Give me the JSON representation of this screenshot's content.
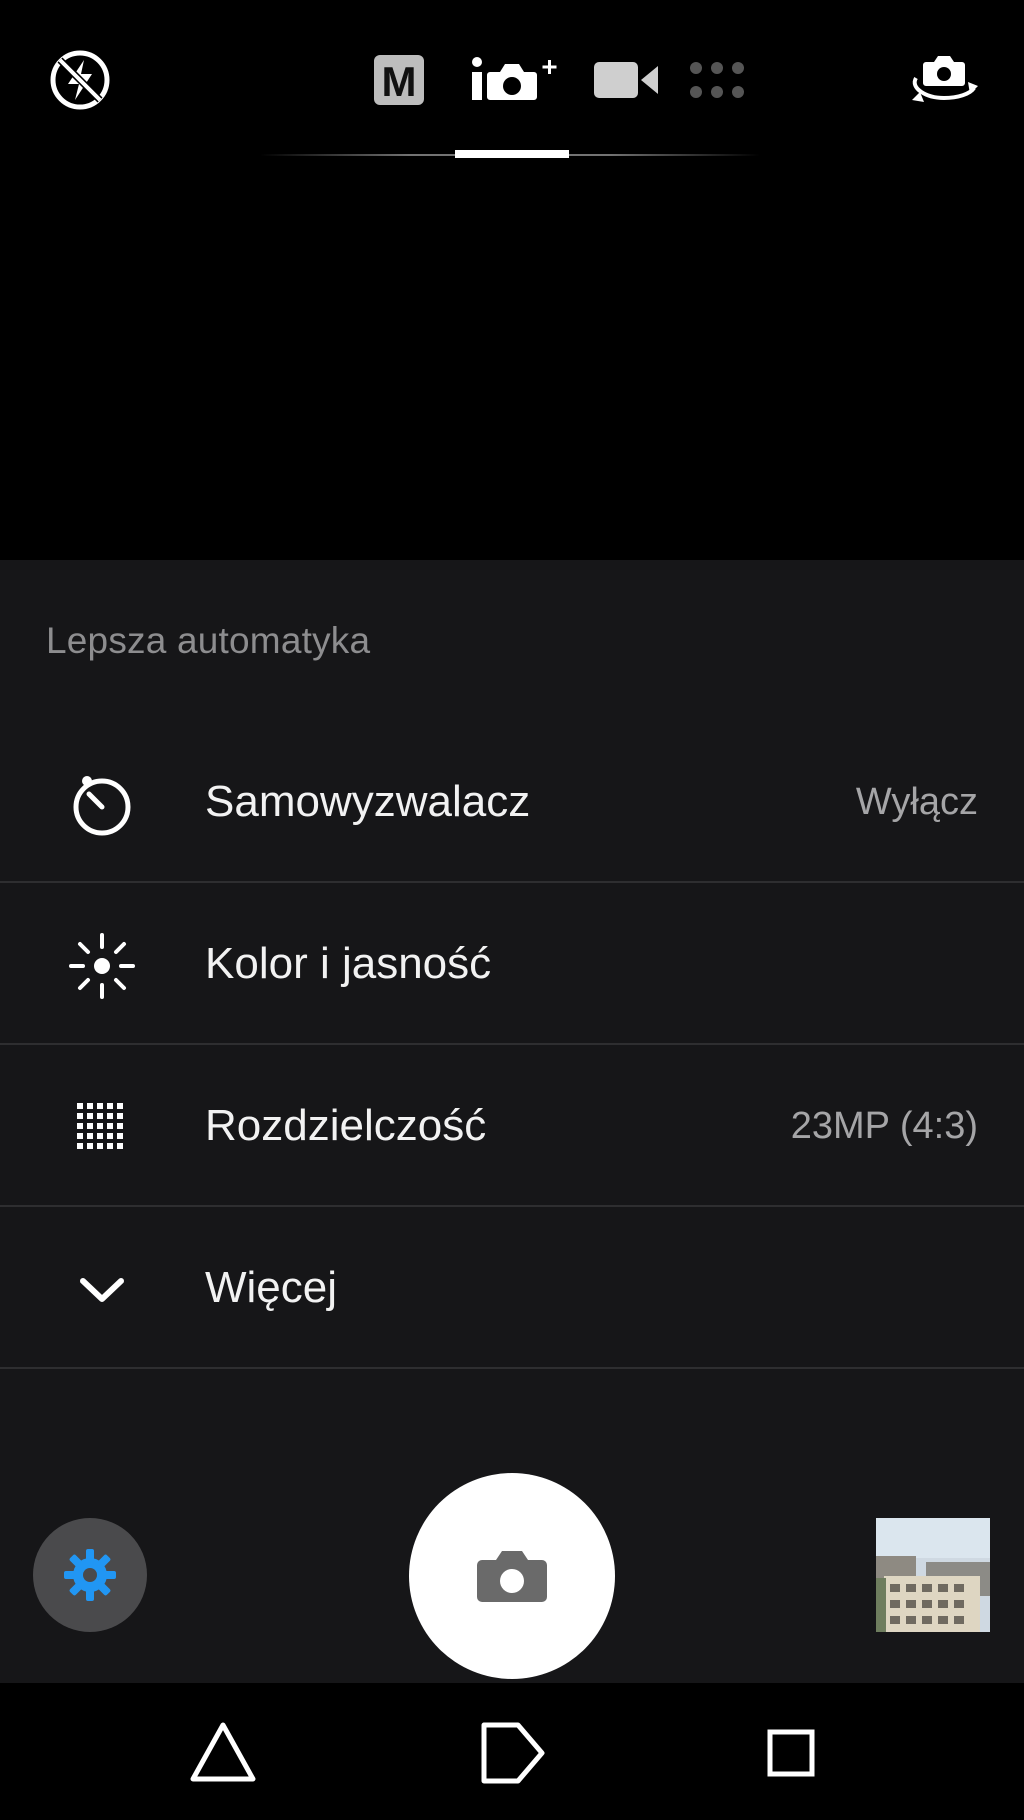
{
  "camera_modes": [
    {
      "id": "manual",
      "icon": "manual-mode-icon",
      "label": "M",
      "active": false
    },
    {
      "id": "auto-plus",
      "icon": "enhanced-auto-icon",
      "active": true
    },
    {
      "id": "video",
      "icon": "video-camera-icon",
      "active": false
    },
    {
      "id": "more",
      "icon": "more-modes-dots-icon",
      "active": false
    }
  ],
  "top_icons": {
    "flash": "flash-auto-icon",
    "switch_camera": "switch-camera-icon"
  },
  "panel": {
    "title": "Lepsza automatyka",
    "rows": [
      {
        "icon": "self-timer-icon",
        "label": "Samowyzwalacz",
        "value": "Wyłącz"
      },
      {
        "icon": "brightness-icon",
        "label": "Kolor i jasność",
        "value": ""
      },
      {
        "icon": "resolution-grid-icon",
        "label": "Rozdzielczość",
        "value": "23MP (4:3)"
      },
      {
        "icon": "chevron-down-icon",
        "label": "Więcej",
        "value": ""
      }
    ]
  },
  "bottom": {
    "settings_icon": "gear-icon",
    "shutter_icon": "camera-icon",
    "thumbnail": "last-photo-thumbnail"
  },
  "navbar": {
    "back_icon": "back-triangle-icon",
    "home_icon": "home-icon",
    "recents_icon": "recents-square-icon"
  },
  "colors": {
    "accent": "#2196F3",
    "panel_bg": "#161618",
    "divider": "#2e2e30",
    "shutter": "#ffffff"
  }
}
